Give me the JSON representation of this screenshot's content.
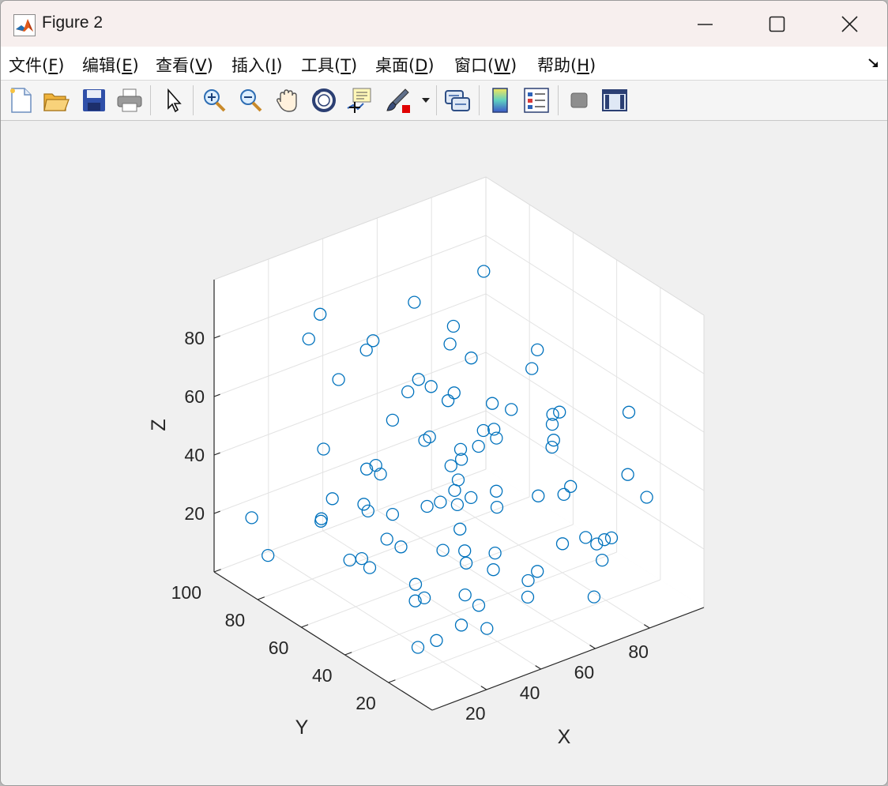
{
  "window": {
    "title": "Figure 2"
  },
  "menu": [
    {
      "label": "文件(",
      "key": "F",
      "tail": ")"
    },
    {
      "label": "编辑(",
      "key": "E",
      "tail": ")"
    },
    {
      "label": "查看(",
      "key": "V",
      "tail": ")"
    },
    {
      "label": "插入(",
      "key": "I",
      "tail": ")"
    },
    {
      "label": "工具(",
      "key": "T",
      "tail": ")"
    },
    {
      "label": "桌面(",
      "key": "D",
      "tail": ")"
    },
    {
      "label": "窗口(",
      "key": "W",
      "tail": ")"
    },
    {
      "label": "帮助(",
      "key": "H",
      "tail": ")"
    }
  ],
  "toolbar": [
    "new-figure-icon",
    "open-file-icon",
    "save-icon",
    "print-icon",
    "pointer-icon",
    "zoom-in-icon",
    "zoom-out-icon",
    "pan-hand-icon",
    "rotate-3d-icon",
    "data-tips-icon",
    "brush-icon",
    "brush-dropdown-icon",
    "link-plot-icon",
    "colorbar-icon",
    "legend-icon",
    "hide-plot-tools-icon",
    "show-plot-tools-icon"
  ],
  "chart_data": {
    "type": "scatter",
    "title": "",
    "xlabel": "X",
    "ylabel": "Y",
    "zlabel": "Z",
    "xlim": [
      0,
      100
    ],
    "ylim": [
      0,
      100
    ],
    "zlim": [
      0,
      100
    ],
    "xticks": [
      20,
      40,
      60,
      80
    ],
    "yticks": [
      20,
      40,
      60,
      80,
      100
    ],
    "zticks": [
      20,
      40,
      60,
      80
    ],
    "grid": true,
    "view": "3d default (azimuth -37.5, elevation 30)",
    "marker": "open circle",
    "marker_color": "#0072BD",
    "points": [
      [
        62,
        29,
        12
      ],
      [
        44,
        73,
        17
      ],
      [
        14,
        4,
        79
      ],
      [
        4,
        3,
        21
      ],
      [
        91,
        55,
        44
      ],
      [
        61,
        63,
        38
      ],
      [
        53,
        11,
        74
      ],
      [
        51,
        36,
        70
      ],
      [
        21,
        76,
        46
      ],
      [
        39,
        40,
        51
      ],
      [
        48,
        42,
        36
      ],
      [
        73,
        12,
        27
      ],
      [
        62,
        56,
        42
      ],
      [
        95,
        20,
        30
      ],
      [
        23,
        31,
        47
      ],
      [
        30,
        66,
        7
      ],
      [
        96,
        71,
        6
      ],
      [
        16,
        15,
        42
      ],
      [
        7,
        41,
        30
      ],
      [
        85,
        51,
        36
      ],
      [
        40,
        61,
        66
      ],
      [
        96,
        96,
        71
      ],
      [
        9,
        62,
        33
      ],
      [
        39,
        52,
        54
      ],
      [
        31,
        90,
        82
      ],
      [
        5,
        52,
        46
      ],
      [
        23,
        60,
        34
      ],
      [
        25,
        57,
        48
      ],
      [
        67,
        54,
        44
      ],
      [
        30,
        94,
        72
      ],
      [
        8,
        61,
        33
      ],
      [
        77,
        84,
        12
      ],
      [
        95,
        48,
        3
      ],
      [
        68,
        75,
        72
      ],
      [
        44,
        11,
        18
      ],
      [
        74,
        2,
        75
      ],
      [
        10,
        19,
        9
      ],
      [
        64,
        20,
        25
      ],
      [
        11,
        89,
        7
      ],
      [
        58,
        96,
        15
      ],
      [
        42,
        24,
        70
      ],
      [
        45,
        28,
        19
      ],
      [
        95,
        58,
        13
      ],
      [
        50,
        26,
        73
      ],
      [
        71,
        65,
        40
      ],
      [
        87,
        79,
        7
      ],
      [
        44,
        26,
        26
      ],
      [
        56,
        78,
        83
      ],
      [
        50,
        52,
        33
      ],
      [
        84,
        15,
        44
      ],
      [
        82,
        94,
        52
      ],
      [
        68,
        81,
        9
      ],
      [
        75,
        18,
        22
      ],
      [
        12,
        45,
        57
      ],
      [
        76,
        49,
        67
      ],
      [
        37,
        21,
        5
      ],
      [
        24,
        57,
        91
      ],
      [
        81,
        23,
        12
      ],
      [
        68,
        72,
        4
      ],
      [
        59,
        74,
        55
      ],
      [
        52,
        95,
        60
      ],
      [
        70,
        5,
        32
      ],
      [
        47,
        88,
        10
      ],
      [
        76,
        65,
        12
      ],
      [
        62,
        70,
        51
      ],
      [
        34,
        21,
        14
      ],
      [
        15,
        33,
        35
      ],
      [
        5,
        14,
        29
      ],
      [
        72,
        34,
        51
      ],
      [
        39,
        33,
        21
      ],
      [
        40,
        68,
        53
      ],
      [
        65,
        37,
        4
      ],
      [
        85,
        88,
        49
      ],
      [
        52,
        66,
        44
      ],
      [
        5,
        89,
        22
      ],
      [
        75,
        30,
        36
      ],
      [
        24,
        15,
        39
      ],
      [
        9,
        49,
        25
      ],
      [
        62,
        22,
        69
      ],
      [
        45,
        46,
        71
      ],
      [
        5,
        27,
        44
      ],
      [
        26,
        40,
        15
      ],
      [
        55,
        57,
        24
      ],
      [
        70,
        13,
        8
      ],
      [
        22,
        31,
        16
      ],
      [
        37,
        89,
        58
      ],
      [
        66,
        34,
        84
      ],
      [
        64,
        86,
        50
      ],
      [
        41,
        36,
        8
      ],
      [
        26,
        19,
        11
      ]
    ]
  }
}
